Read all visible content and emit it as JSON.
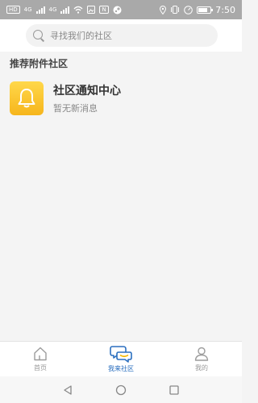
{
  "status_bar": {
    "carrier_badge": "HD",
    "network_1": "4G",
    "network_2": "4G",
    "nfc_badge": "N",
    "time": "7:50"
  },
  "search": {
    "placeholder": "寻找我们的社区"
  },
  "section": {
    "title": "推荐附件社区"
  },
  "notification": {
    "title": "社区通知中心",
    "subtitle": "暂无新消息",
    "icon": "bell-icon",
    "icon_color": "#f7b928"
  },
  "tabs": [
    {
      "label": "首页",
      "icon": "home-icon",
      "active": false
    },
    {
      "label": "我来社区",
      "icon": "chat-bubble-icon",
      "active": true
    },
    {
      "label": "我的",
      "icon": "user-icon",
      "active": false
    }
  ],
  "colors": {
    "status_bar_bg": "#a9a9a9",
    "active_tab": "#2b6fbf",
    "background": "#f4f4f4"
  }
}
